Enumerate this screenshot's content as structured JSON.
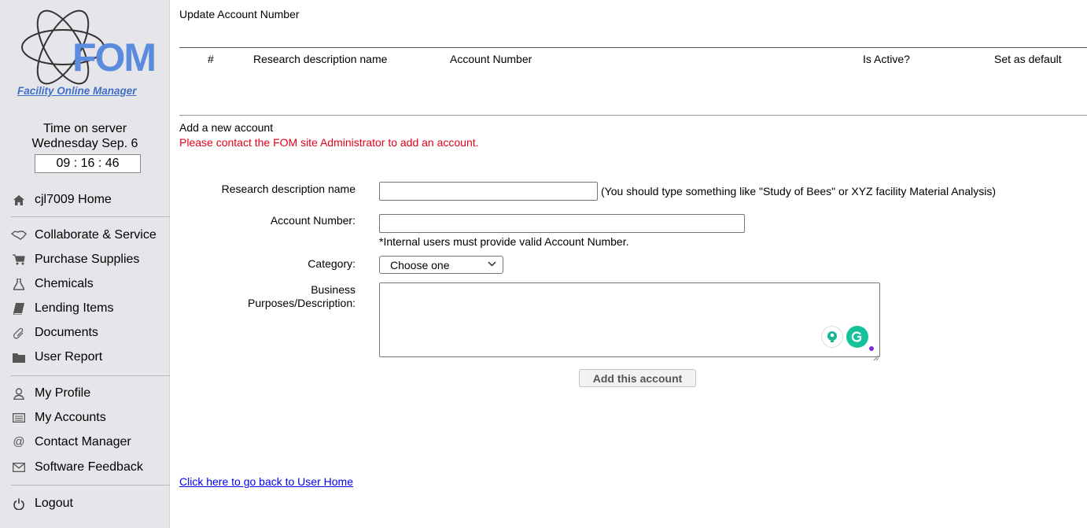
{
  "logo": {
    "text": "FOM",
    "tagline": "Facility Online Manager"
  },
  "clock": {
    "title": "Time on server",
    "date": "Wednesday Sep. 6",
    "time": "09 : 16 : 46"
  },
  "sidebar": {
    "home": {
      "label": "cjl7009 Home",
      "icon": "home-icon"
    },
    "group1": [
      {
        "label": "Collaborate & Service",
        "icon": "handshake-icon"
      },
      {
        "label": "Purchase Supplies",
        "icon": "cart-icon"
      },
      {
        "label": "Chemicals",
        "icon": "flask-icon"
      },
      {
        "label": "Lending Items",
        "icon": "book-icon"
      },
      {
        "label": "Documents",
        "icon": "paperclip-icon"
      },
      {
        "label": "User Report",
        "icon": "folder-icon"
      }
    ],
    "group2": [
      {
        "label": "My Profile",
        "icon": "user-icon"
      },
      {
        "label": "My Accounts",
        "icon": "list-icon"
      },
      {
        "label": "Contact Manager",
        "icon": "at-icon"
      },
      {
        "label": "Software Feedback",
        "icon": "envelope-icon"
      }
    ],
    "logout": {
      "label": "Logout",
      "icon": "power-icon"
    }
  },
  "page": {
    "title": "Update Account Number",
    "table_headers": [
      "#",
      "Research description name",
      "Account Number",
      "Is Active?",
      "Set as default"
    ],
    "add_heading": "Add a new account",
    "add_notice": "Please contact the FOM site Administrator to add an account."
  },
  "form": {
    "research_label": "Research description name",
    "research_value": "",
    "research_hint": "(You should type something like \"Study of Bees\" or XYZ facility Material Analysis)",
    "account_label": "Account Number:",
    "account_value": "",
    "account_hint": "*Internal users must provide valid Account Number.",
    "category_label": "Category:",
    "category_selected": "Choose one",
    "business_label_line1": "Business",
    "business_label_line2": "Purposes/Description:",
    "business_value": "",
    "submit_label": "Add this account"
  },
  "back_link": "Click here to go back to User Home",
  "colors": {
    "sidebar_bg": "#e6e6ea",
    "logo_blue": "#5b8bdc",
    "notice_red": "#e2001a",
    "link_blue": "#0000ee",
    "grammarly_green": "#15c39a"
  }
}
